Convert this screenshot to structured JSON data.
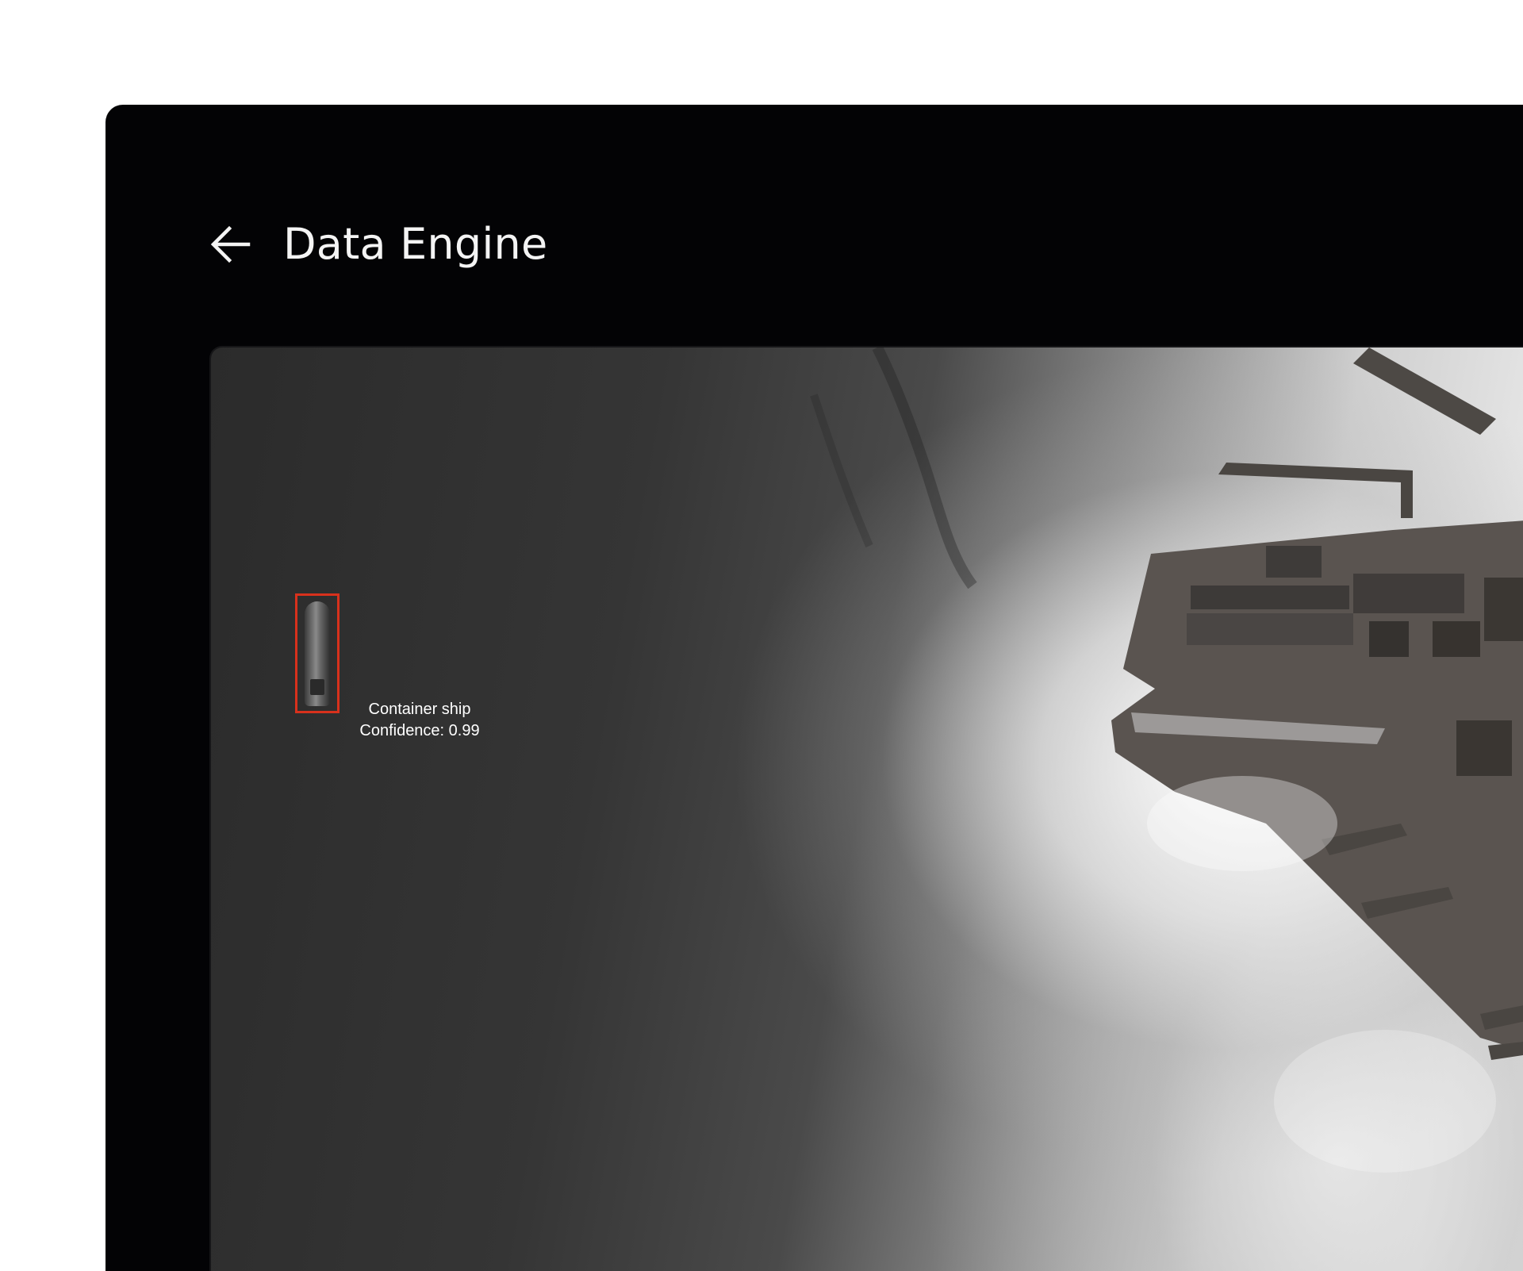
{
  "header": {
    "title": "Data Engine",
    "back_icon": "arrow-left-icon"
  },
  "viewer": {
    "detections": [
      {
        "label": "Container ship",
        "confidence_text": "Confidence: 0.99",
        "confidence": 0.99,
        "box_color": "#d8311c"
      }
    ]
  },
  "colors": {
    "window_bg": "#030305",
    "page_bg": "#ffffff",
    "title_text": "#f4f4f4",
    "detection_box": "#d8311c"
  }
}
